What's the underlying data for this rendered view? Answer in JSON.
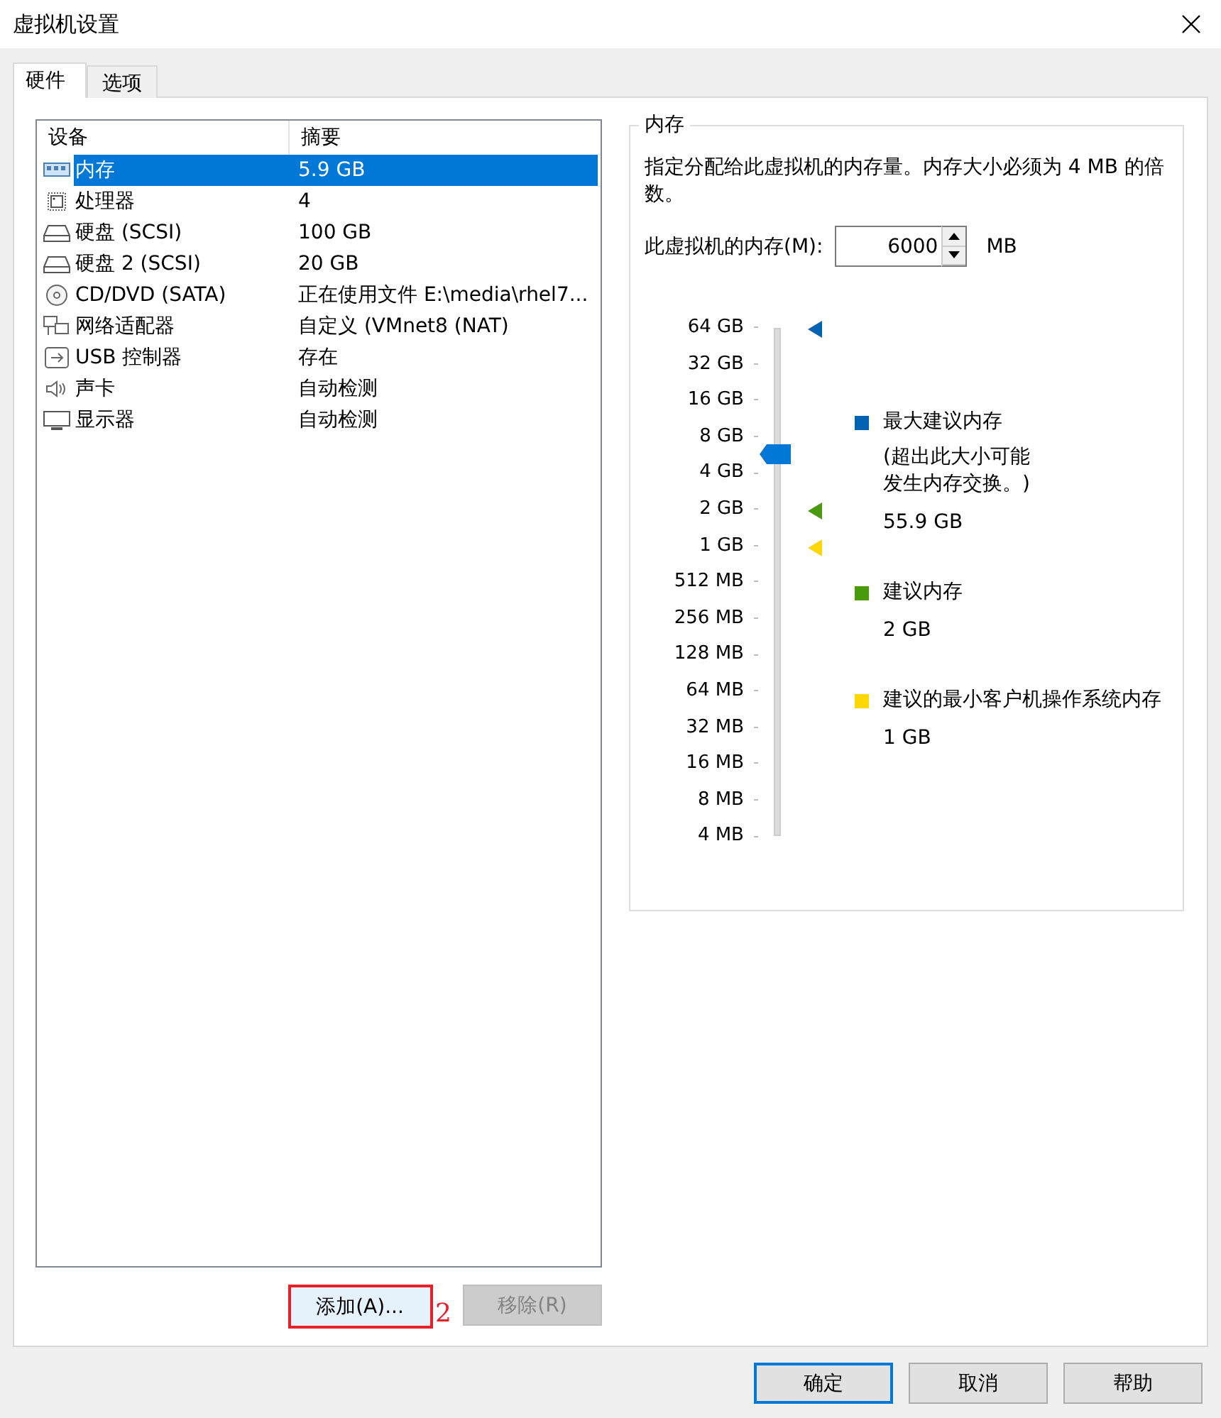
{
  "window": {
    "title": "虚拟机设置"
  },
  "tabs": [
    {
      "label": "硬件",
      "selected": true
    },
    {
      "label": "选项",
      "selected": false
    }
  ],
  "device_table": {
    "columns": [
      "设备",
      "摘要"
    ],
    "rows": [
      {
        "kind": "memory",
        "device": "内存",
        "summary": "5.9 GB",
        "selected": true
      },
      {
        "kind": "cpu",
        "device": "处理器",
        "summary": "4",
        "selected": false
      },
      {
        "kind": "disk",
        "device": "硬盘 (SCSI)",
        "summary": "100 GB",
        "selected": false
      },
      {
        "kind": "disk",
        "device": "硬盘 2 (SCSI)",
        "summary": "20 GB",
        "selected": false
      },
      {
        "kind": "cd",
        "device": "CD/DVD (SATA)",
        "summary": "正在使用文件 E:\\media\\rhel7...",
        "selected": false
      },
      {
        "kind": "network",
        "device": "网络适配器",
        "summary": "自定义 (VMnet8 (NAT)",
        "selected": false
      },
      {
        "kind": "usb",
        "device": "USB 控制器",
        "summary": "存在",
        "selected": false
      },
      {
        "kind": "sound",
        "device": "声卡",
        "summary": "自动检测",
        "selected": false
      },
      {
        "kind": "display",
        "device": "显示器",
        "summary": "自动检测",
        "selected": false
      }
    ]
  },
  "list_buttons": [
    {
      "label": "添加(A)...",
      "disabled": false,
      "highlighted": true
    },
    {
      "label": "移除(R)",
      "disabled": true,
      "highlighted": false
    }
  ],
  "annotation": {
    "label": "2"
  },
  "memory": {
    "title": "内存",
    "description": "指定分配给此虚拟机的内存量。内存大小必须为 4 MB 的倍数。",
    "field_label": "此虚拟机的内存(M):",
    "value": "6000",
    "unit": "MB",
    "scale": [
      "64 GB",
      "32 GB",
      "16 GB",
      "8 GB",
      "4 GB",
      "2 GB",
      "1 GB",
      "512 MB",
      "256 MB",
      "128 MB",
      "64 MB",
      "32 MB",
      "16 MB",
      "8 MB",
      "4 MB"
    ],
    "slider": {
      "level": 0.754,
      "markers": [
        {
          "color": "#0063b1",
          "level": 1
        },
        {
          "color": "#4a9a0e",
          "level": 0.643
        },
        {
          "color": "#ffd800",
          "level": 0.571
        }
      ]
    },
    "legend": [
      {
        "label": "最大建议内存",
        "note": "(超出此大小可能发生内存交换。)",
        "value": "55.9 GB",
        "color": "#0063b1"
      },
      {
        "label": "建议内存",
        "value": "2 GB",
        "color": "#4a9a0e"
      },
      {
        "label": "建议的最小客户机操作系统内存",
        "value": "1 GB",
        "color": "#ffd800"
      }
    ]
  },
  "dialog_buttons": [
    {
      "label": "确定",
      "default": true
    },
    {
      "label": "取消",
      "default": false
    },
    {
      "label": "帮助",
      "default": false
    }
  ]
}
